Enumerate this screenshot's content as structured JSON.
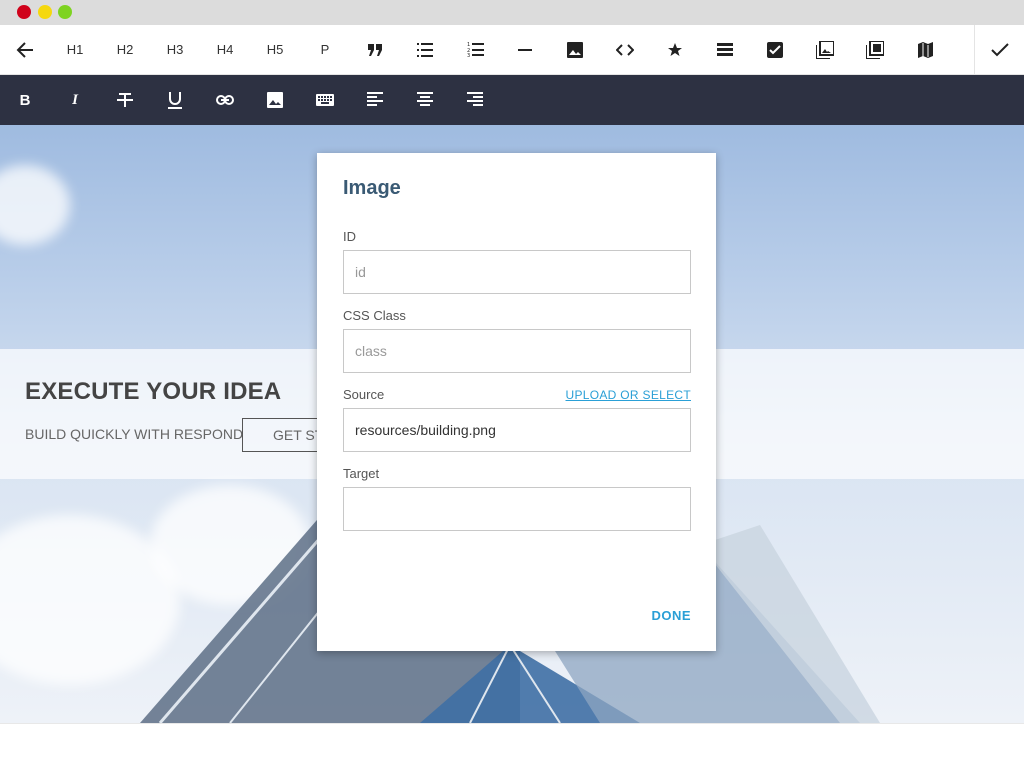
{
  "toolbar": {
    "back_icon": "arrow-left-icon",
    "h1": "H1",
    "h2": "H2",
    "h3": "H3",
    "h4": "H4",
    "h5": "H5",
    "p": "P",
    "icons": [
      "quote-icon",
      "bullet-list-icon",
      "numbered-list-icon",
      "horizontal-rule-icon",
      "image-icon",
      "code-icon",
      "star-icon",
      "table-icon",
      "checkbox-icon",
      "gallery-icon",
      "slideshow-icon",
      "map-icon"
    ],
    "confirm_icon": "check-icon"
  },
  "format_toolbar": {
    "icons": [
      "bold-icon",
      "italic-icon",
      "strikethrough-icon",
      "underline-icon",
      "link-icon",
      "image-icon",
      "keyboard-icon",
      "align-left-icon",
      "align-center-icon",
      "align-right-icon"
    ]
  },
  "hero": {
    "headline": "EXECUTE YOUR IDEA",
    "subline": "BUILD QUICKLY WITH RESPOND",
    "cta": "GET ST"
  },
  "modal": {
    "title": "Image",
    "id_label": "ID",
    "id_placeholder": "id",
    "id_value": "",
    "class_label": "CSS Class",
    "class_placeholder": "class",
    "class_value": "",
    "source_label": "Source",
    "source_link": "UPLOAD OR SELECT",
    "source_value": "resources/building.png",
    "target_label": "Target",
    "target_value": "",
    "done": "DONE"
  },
  "colors": {
    "dark_toolbar": "#2d3142",
    "accent": "#2a9fd6",
    "title": "#3a5a74"
  }
}
